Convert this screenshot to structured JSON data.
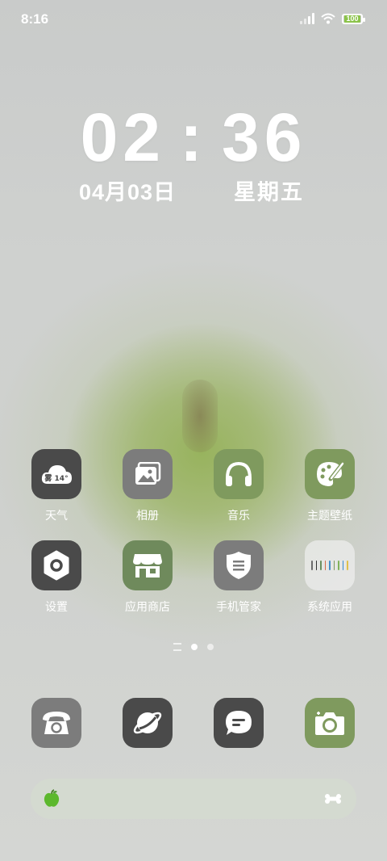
{
  "status_bar": {
    "time": "8:16",
    "battery": "100"
  },
  "lockscreen": {
    "hour": "02",
    "colon": ":",
    "minute": "36",
    "date": "04月03日",
    "weekday": "星期五"
  },
  "apps_row1": [
    {
      "label": "天气",
      "icon": "weather-cloud-icon",
      "badge": "雾 14°"
    },
    {
      "label": "相册",
      "icon": "gallery-icon"
    },
    {
      "label": "音乐",
      "icon": "headphones-icon"
    },
    {
      "label": "主题壁纸",
      "icon": "palette-icon"
    }
  ],
  "apps_row2": [
    {
      "label": "设置",
      "icon": "settings-icon"
    },
    {
      "label": "应用商店",
      "icon": "store-icon"
    },
    {
      "label": "手机管家",
      "icon": "shield-icon"
    },
    {
      "label": "系统应用",
      "icon": "folder-icon"
    }
  ],
  "dock": [
    {
      "icon": "phone-icon"
    },
    {
      "icon": "browser-icon"
    },
    {
      "icon": "messages-icon"
    },
    {
      "icon": "camera-icon"
    }
  ],
  "colors": {
    "dark_tile": "#4a4a4a",
    "gray_tile": "#7c7c7c",
    "green_tile": "#7f9a5e",
    "battery_fill": "#8bc34a"
  }
}
